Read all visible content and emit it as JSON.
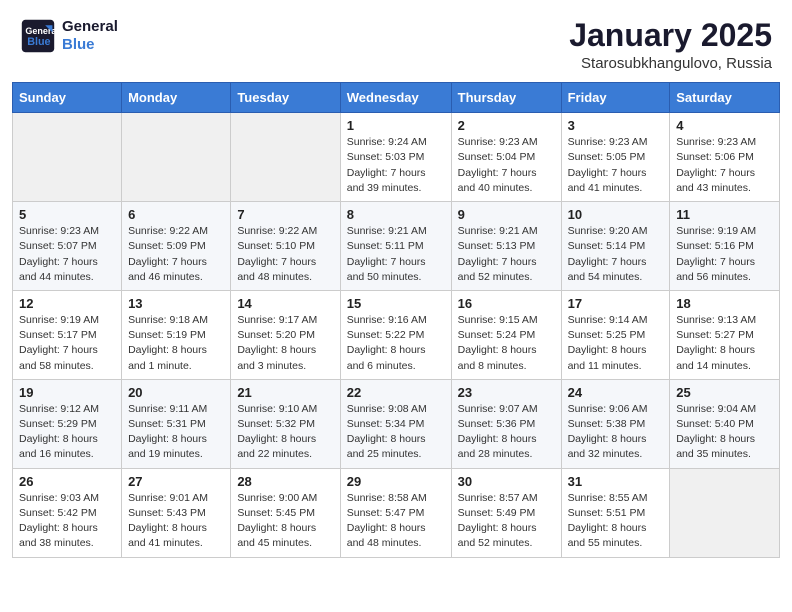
{
  "header": {
    "logo_line1": "General",
    "logo_line2": "Blue",
    "month_title": "January 2025",
    "subtitle": "Starosubkhangulovo, Russia"
  },
  "days_of_week": [
    "Sunday",
    "Monday",
    "Tuesday",
    "Wednesday",
    "Thursday",
    "Friday",
    "Saturday"
  ],
  "weeks": [
    [
      {
        "day": "",
        "info": ""
      },
      {
        "day": "",
        "info": ""
      },
      {
        "day": "",
        "info": ""
      },
      {
        "day": "1",
        "info": "Sunrise: 9:24 AM\nSunset: 5:03 PM\nDaylight: 7 hours\nand 39 minutes."
      },
      {
        "day": "2",
        "info": "Sunrise: 9:23 AM\nSunset: 5:04 PM\nDaylight: 7 hours\nand 40 minutes."
      },
      {
        "day": "3",
        "info": "Sunrise: 9:23 AM\nSunset: 5:05 PM\nDaylight: 7 hours\nand 41 minutes."
      },
      {
        "day": "4",
        "info": "Sunrise: 9:23 AM\nSunset: 5:06 PM\nDaylight: 7 hours\nand 43 minutes."
      }
    ],
    [
      {
        "day": "5",
        "info": "Sunrise: 9:23 AM\nSunset: 5:07 PM\nDaylight: 7 hours\nand 44 minutes."
      },
      {
        "day": "6",
        "info": "Sunrise: 9:22 AM\nSunset: 5:09 PM\nDaylight: 7 hours\nand 46 minutes."
      },
      {
        "day": "7",
        "info": "Sunrise: 9:22 AM\nSunset: 5:10 PM\nDaylight: 7 hours\nand 48 minutes."
      },
      {
        "day": "8",
        "info": "Sunrise: 9:21 AM\nSunset: 5:11 PM\nDaylight: 7 hours\nand 50 minutes."
      },
      {
        "day": "9",
        "info": "Sunrise: 9:21 AM\nSunset: 5:13 PM\nDaylight: 7 hours\nand 52 minutes."
      },
      {
        "day": "10",
        "info": "Sunrise: 9:20 AM\nSunset: 5:14 PM\nDaylight: 7 hours\nand 54 minutes."
      },
      {
        "day": "11",
        "info": "Sunrise: 9:19 AM\nSunset: 5:16 PM\nDaylight: 7 hours\nand 56 minutes."
      }
    ],
    [
      {
        "day": "12",
        "info": "Sunrise: 9:19 AM\nSunset: 5:17 PM\nDaylight: 7 hours\nand 58 minutes."
      },
      {
        "day": "13",
        "info": "Sunrise: 9:18 AM\nSunset: 5:19 PM\nDaylight: 8 hours\nand 1 minute."
      },
      {
        "day": "14",
        "info": "Sunrise: 9:17 AM\nSunset: 5:20 PM\nDaylight: 8 hours\nand 3 minutes."
      },
      {
        "day": "15",
        "info": "Sunrise: 9:16 AM\nSunset: 5:22 PM\nDaylight: 8 hours\nand 6 minutes."
      },
      {
        "day": "16",
        "info": "Sunrise: 9:15 AM\nSunset: 5:24 PM\nDaylight: 8 hours\nand 8 minutes."
      },
      {
        "day": "17",
        "info": "Sunrise: 9:14 AM\nSunset: 5:25 PM\nDaylight: 8 hours\nand 11 minutes."
      },
      {
        "day": "18",
        "info": "Sunrise: 9:13 AM\nSunset: 5:27 PM\nDaylight: 8 hours\nand 14 minutes."
      }
    ],
    [
      {
        "day": "19",
        "info": "Sunrise: 9:12 AM\nSunset: 5:29 PM\nDaylight: 8 hours\nand 16 minutes."
      },
      {
        "day": "20",
        "info": "Sunrise: 9:11 AM\nSunset: 5:31 PM\nDaylight: 8 hours\nand 19 minutes."
      },
      {
        "day": "21",
        "info": "Sunrise: 9:10 AM\nSunset: 5:32 PM\nDaylight: 8 hours\nand 22 minutes."
      },
      {
        "day": "22",
        "info": "Sunrise: 9:08 AM\nSunset: 5:34 PM\nDaylight: 8 hours\nand 25 minutes."
      },
      {
        "day": "23",
        "info": "Sunrise: 9:07 AM\nSunset: 5:36 PM\nDaylight: 8 hours\nand 28 minutes."
      },
      {
        "day": "24",
        "info": "Sunrise: 9:06 AM\nSunset: 5:38 PM\nDaylight: 8 hours\nand 32 minutes."
      },
      {
        "day": "25",
        "info": "Sunrise: 9:04 AM\nSunset: 5:40 PM\nDaylight: 8 hours\nand 35 minutes."
      }
    ],
    [
      {
        "day": "26",
        "info": "Sunrise: 9:03 AM\nSunset: 5:42 PM\nDaylight: 8 hours\nand 38 minutes."
      },
      {
        "day": "27",
        "info": "Sunrise: 9:01 AM\nSunset: 5:43 PM\nDaylight: 8 hours\nand 41 minutes."
      },
      {
        "day": "28",
        "info": "Sunrise: 9:00 AM\nSunset: 5:45 PM\nDaylight: 8 hours\nand 45 minutes."
      },
      {
        "day": "29",
        "info": "Sunrise: 8:58 AM\nSunset: 5:47 PM\nDaylight: 8 hours\nand 48 minutes."
      },
      {
        "day": "30",
        "info": "Sunrise: 8:57 AM\nSunset: 5:49 PM\nDaylight: 8 hours\nand 52 minutes."
      },
      {
        "day": "31",
        "info": "Sunrise: 8:55 AM\nSunset: 5:51 PM\nDaylight: 8 hours\nand 55 minutes."
      },
      {
        "day": "",
        "info": ""
      }
    ]
  ]
}
